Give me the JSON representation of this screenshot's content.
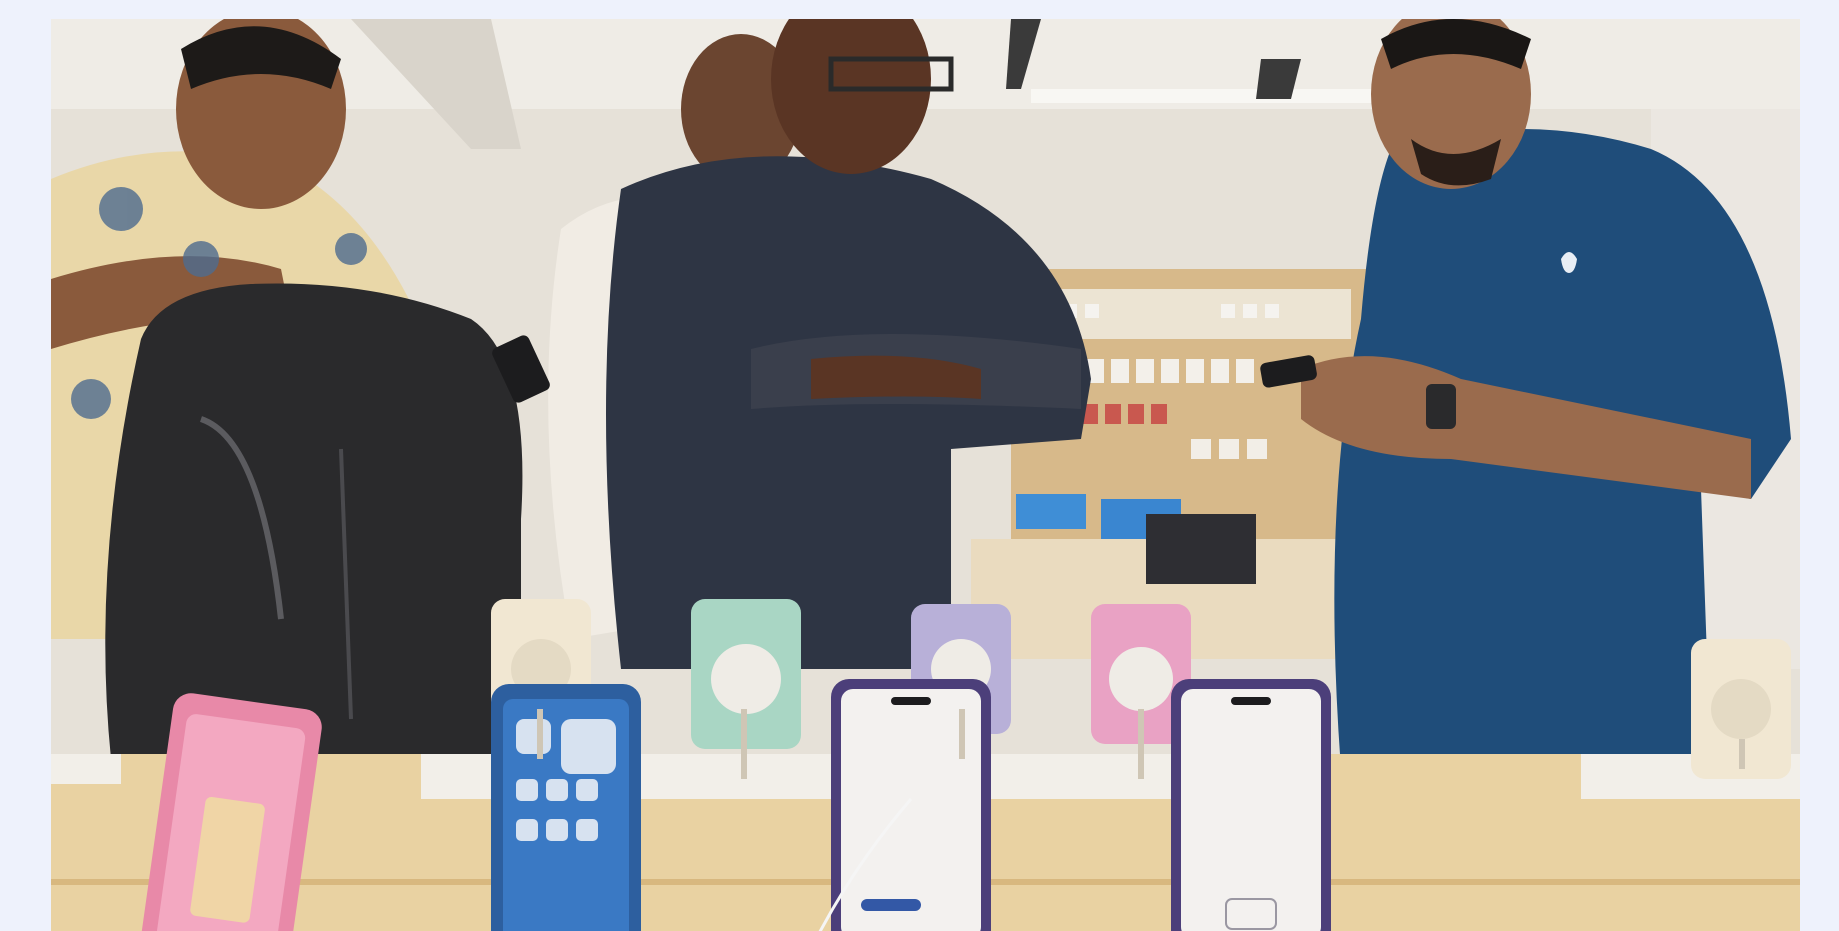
{
  "image": {
    "subject": "customers-at-store-phone-display-table",
    "colors": {
      "page_background": "#eef2fc",
      "wall": "#e6e1d8",
      "ceiling": "#efece6",
      "table_top": "#e9d2a2",
      "table_edge": "#d8b87f",
      "shelf_wood": "#d7b98a",
      "shirt_navy": "#1f4d7a",
      "shirt_check": "#2e3544",
      "shirt_floral": "#e9d7a8",
      "backpack": "#2a2a2c",
      "phone_pink": "#e889a8",
      "phone_blue": "#3a79c4",
      "phone_white": "#f3f1ef",
      "phone_green": "#a9d6c4",
      "phone_lilac": "#b8b0d8",
      "phone_rose": "#e9a2c4",
      "phone_cream": "#f1e7d2"
    }
  }
}
